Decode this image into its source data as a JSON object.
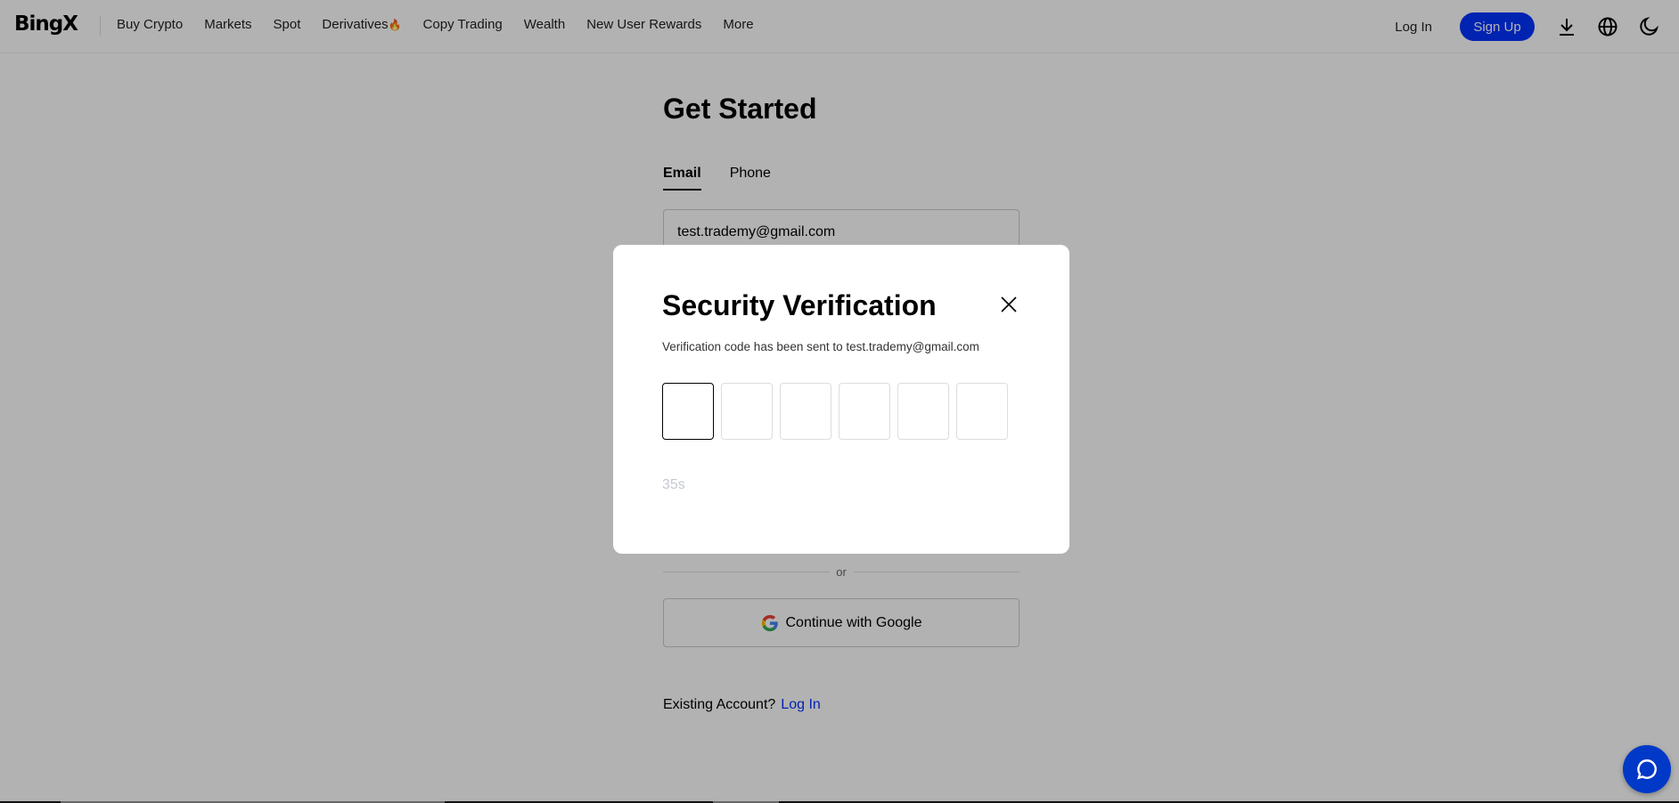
{
  "header": {
    "logo": "BingX",
    "nav": [
      "Buy Crypto",
      "Markets",
      "Spot",
      "Derivatives",
      "Copy Trading",
      "Wealth",
      "New User Rewards",
      "More"
    ],
    "derivatives_badge_icon": "fire-icon",
    "login": "Log In",
    "signup": "Sign Up",
    "icons": [
      "download-icon",
      "globe-icon",
      "moon-icon"
    ],
    "accent": "#0033ff"
  },
  "form": {
    "title": "Get Started",
    "tabs": [
      "Email",
      "Phone"
    ],
    "active_tab": "Email",
    "email_value": "test.trademy@gmail.com",
    "or": "or",
    "google": "Continue with Google",
    "existing": "Existing Account?",
    "login_link": "Log In"
  },
  "modal": {
    "title": "Security Verification",
    "subtitle": "Verification code has been sent to test.trademy@gmail.com",
    "code_digits": [
      "",
      "",
      "",
      "",
      "",
      ""
    ],
    "timer": "35s"
  }
}
